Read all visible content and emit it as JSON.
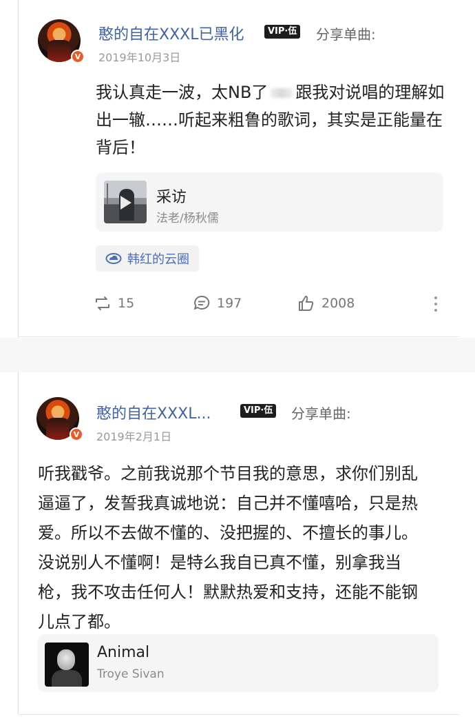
{
  "posts": [
    {
      "username": "憨的自在XXXL已黑化",
      "vip_badge": "VIP·伍",
      "action": "分享单曲:",
      "date": "2019年10月3日",
      "verified_mark": "V",
      "text_part1": "我认真走一波，太NB了",
      "text_part2": "跟我对说唱的理解如出一辙……听起来粗鲁的歌词，其实是正能量在背后！",
      "song": {
        "title": "采访",
        "artist": "法老/杨秋儒",
        "cover_icon": "play-icon"
      },
      "topic": {
        "label": "韩红的云圈",
        "icon": "cloud-circle-icon"
      },
      "stats": {
        "reposts": "15",
        "comments": "197",
        "likes": "2008"
      }
    },
    {
      "username": "憨的自在XXXL...",
      "vip_badge": "VIP·伍",
      "action": "分享单曲:",
      "date": "2019年2月1日",
      "verified_mark": "V",
      "text": "听我戳爷。之前我说那个节目我的意思，求你们别乱逼逼了，发誓我真诚地说：自己并不懂嘻哈，只是热爱。所以不去做不懂的、没把握的、不擅长的事儿。没说别人不懂啊！是特么我自已真不懂，别拿我当枪，我不攻击任何人！默默热爱和支持，还能不能钢儿点了都。",
      "song": {
        "title": "Animal",
        "artist": "Troye Sivan"
      }
    }
  ],
  "colors": {
    "username": "#3f62a8",
    "verified": "#ea5a29",
    "topic_text": "#4a6fb5",
    "vip_bg": "#1e1e1e"
  }
}
